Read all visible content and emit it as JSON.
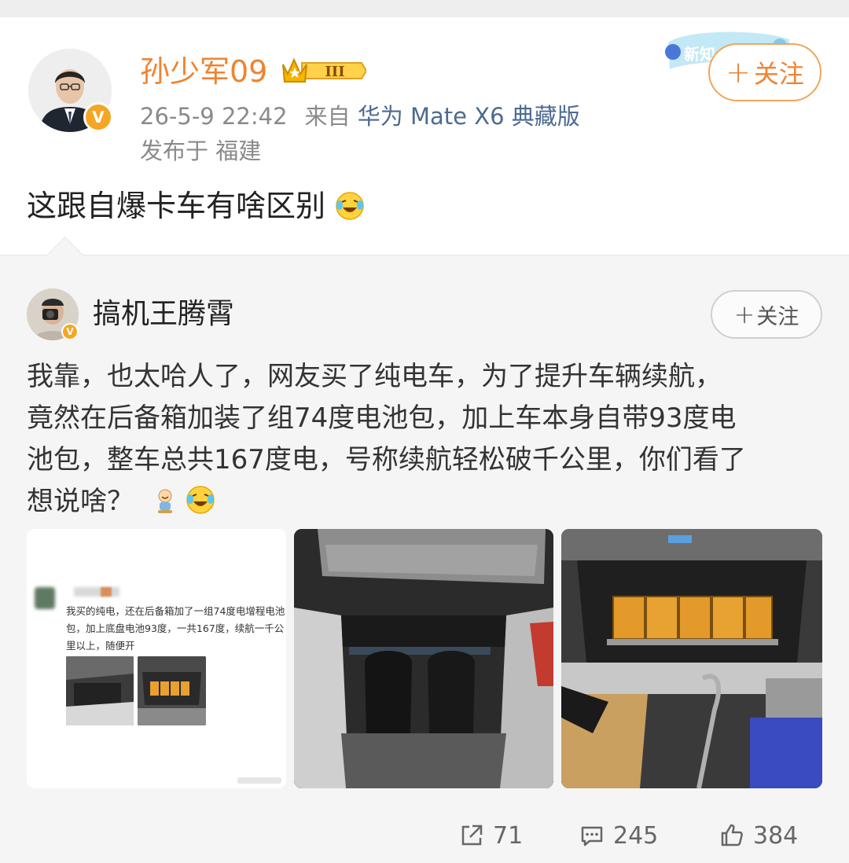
{
  "post": {
    "author": "孙少军09",
    "verified_mark": "V",
    "level_badge": "III",
    "new_badge": "新知",
    "time": "26-5-9 22:42",
    "from_prefix": "来自",
    "device": "华为 Mate X6 典藏版",
    "location": "发布于 福建",
    "follow_plus": "+",
    "follow_label": "关注",
    "text": "这跟自爆卡车有啥区别"
  },
  "quote": {
    "author": "搞机王腾霄",
    "verified_mark": "V",
    "follow_plus": "+",
    "follow_label": "关注",
    "text_lines": [
      "我靠，也太哈人了，网友买了纯电车，为了提升车辆续航，",
      "竟然在后备箱加装了组74度电池包，加上车本身自带93度电",
      "池包，整车总共167度电，号称续航轻松破千公里，你们看了",
      "想说啥？"
    ],
    "image1_text": "我买的纯电，还在后备箱加了一组74度电增程电池包，加上底盘电池93度，一共167度，续航一千公里以上，随便开"
  },
  "actions": {
    "share_count": "71",
    "comment_count": "245",
    "like_count": "384"
  },
  "icons": {
    "share": "share-icon",
    "comment": "comment-icon",
    "like": "thumbs-up-icon",
    "laugh": "laugh-cry-emoji"
  },
  "colors": {
    "accent_orange": "#f08330",
    "device_blue": "#4c6a8f",
    "muted_gray": "#8a8a8a",
    "verified_gold": "#f5a623"
  }
}
